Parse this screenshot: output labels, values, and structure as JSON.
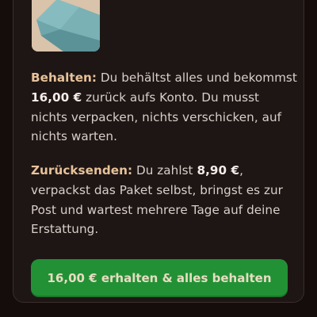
{
  "product": {
    "icon": "folded-towel-image"
  },
  "keep_option": {
    "label": "Behalten:",
    "text_1": " Du behältst alles und bekommst ",
    "amount": "16,00 €",
    "text_2": " zurück aufs Konto. Du musst nichts verpacken, nichts verschicken, auf nichts warten."
  },
  "return_option": {
    "label": "Zurücksenden:",
    "text_1": " Du zahlst ",
    "amount": "8,90 €",
    "text_2": ", verpackst das Paket selbst, bringst es zur Post und wartest mehrere Tage auf deine Erstattung."
  },
  "cta": {
    "label": "16,00 € erhalten & alles behalten"
  },
  "colors": {
    "background": "#140d0b",
    "card": "#1e1614",
    "accent_label": "#e7c29a",
    "button": "#229135",
    "button_text": "#e8dcc2"
  }
}
